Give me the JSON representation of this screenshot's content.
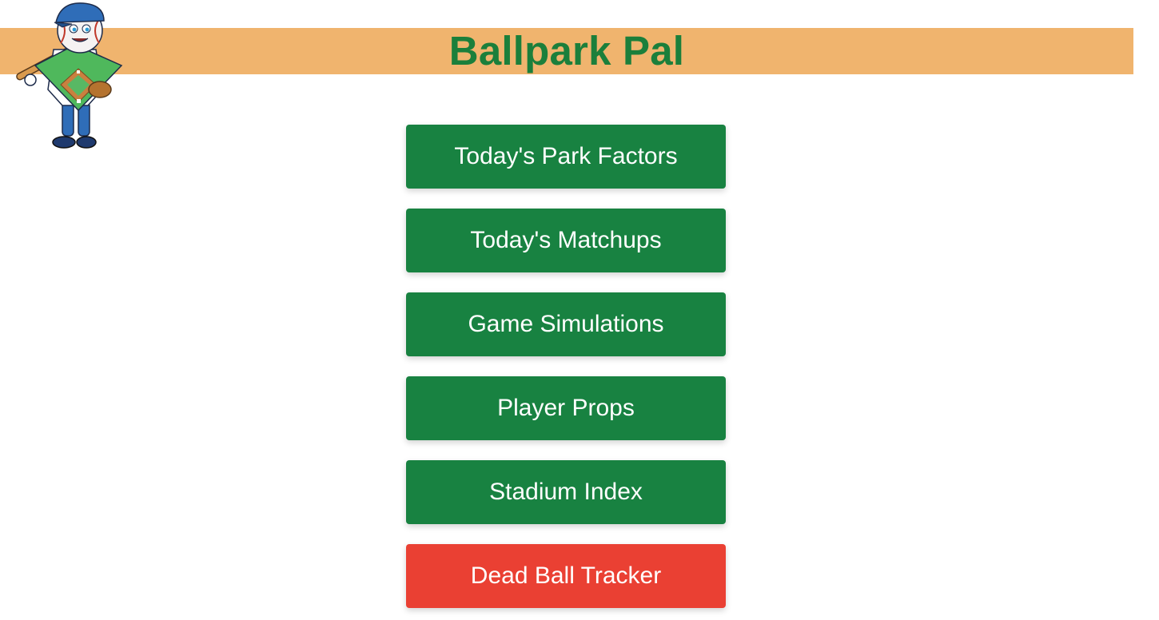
{
  "header": {
    "title": "Ballpark Pal",
    "band_color": "#f0b46e",
    "title_color": "#1b7f3b",
    "logo_icon": "baseball-mascot-logo"
  },
  "nav": {
    "items": [
      {
        "label": "Today's Park Factors",
        "color": "#188241"
      },
      {
        "label": "Today's Matchups",
        "color": "#188241"
      },
      {
        "label": "Game Simulations",
        "color": "#188241"
      },
      {
        "label": "Player Props",
        "color": "#188241"
      },
      {
        "label": "Stadium Index",
        "color": "#188241"
      },
      {
        "label": "Dead Ball Tracker",
        "color": "#ea4033"
      }
    ]
  }
}
